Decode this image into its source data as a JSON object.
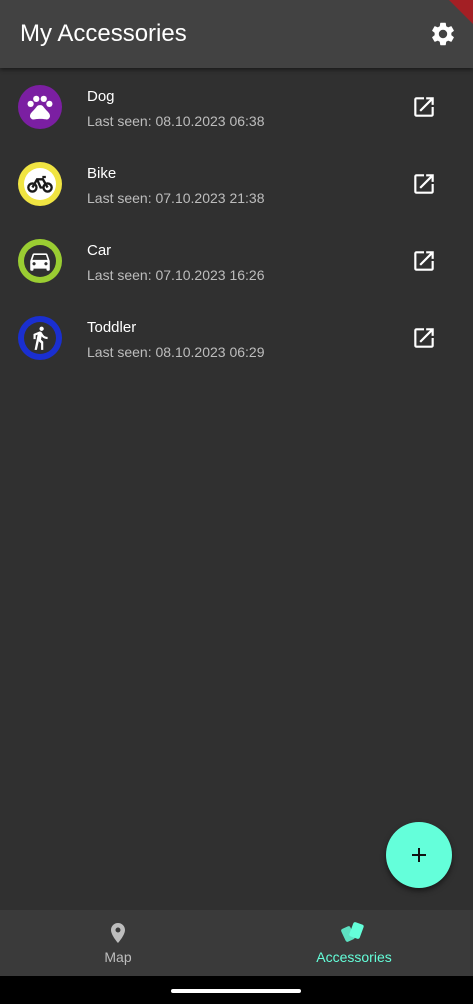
{
  "appbar": {
    "title": "My Accessories",
    "settings_icon": "gear-icon"
  },
  "accessories": [
    {
      "name": "Dog",
      "last_seen": "Last seen: 08.10.2023 06:38",
      "icon": "paw-icon",
      "ring_color": "#7b1fa2"
    },
    {
      "name": "Bike",
      "last_seen": "Last seen: 07.10.2023 21:38",
      "icon": "bike-icon",
      "ring_color": "#f0e442"
    },
    {
      "name": "Car",
      "last_seen": "Last seen: 07.10.2023 16:26",
      "icon": "car-icon",
      "ring_color": "#9acd32"
    },
    {
      "name": "Toddler",
      "last_seen": "Last seen: 08.10.2023 06:29",
      "icon": "walking-person-icon",
      "ring_color": "#1a2fd0"
    }
  ],
  "fab": {
    "icon": "plus-icon"
  },
  "bottom_nav": {
    "items": [
      {
        "label": "Map",
        "icon": "map-pin-icon",
        "active": false
      },
      {
        "label": "Accessories",
        "icon": "tag-icon",
        "active": true
      }
    ],
    "active_color": "#64ffda",
    "inactive_color": "#bdbdbd"
  },
  "colors": {
    "accent": "#64ffda",
    "appbar": "#424242",
    "background": "#303030"
  }
}
